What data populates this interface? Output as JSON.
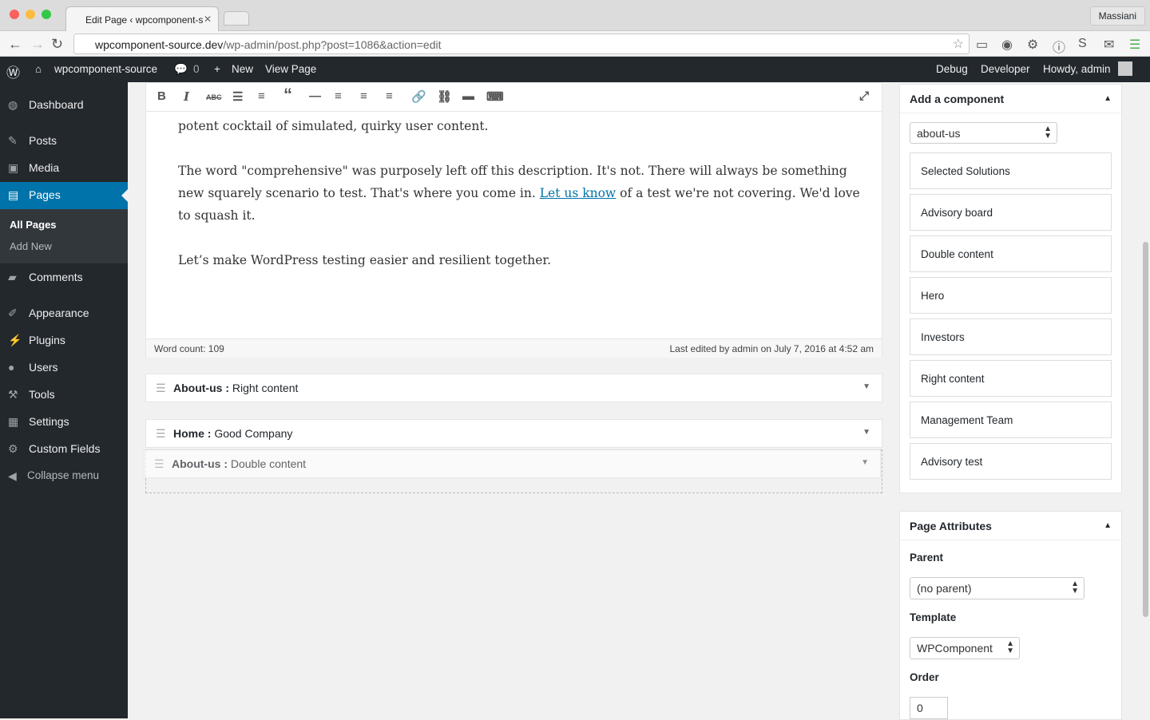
{
  "browser": {
    "tab_title": "Edit Page ‹ wpcomponent-s",
    "user": "Massiani",
    "url_host": "wpcomponent-source.dev",
    "url_path": "/wp-admin/post.php?post=1086&action=edit"
  },
  "adminbar": {
    "site_name": "wpcomponent-source",
    "comments_count": "0",
    "new_label": "New",
    "view_page": "View Page",
    "debug": "Debug",
    "developer": "Developer",
    "howdy": "Howdy, admin"
  },
  "sidebar": {
    "items": [
      {
        "label": "Dashboard",
        "icon": "dashboard-icon"
      },
      {
        "label": "Posts",
        "icon": "pin-icon"
      },
      {
        "label": "Media",
        "icon": "media-icon"
      },
      {
        "label": "Pages",
        "icon": "pages-icon"
      },
      {
        "label": "Comments",
        "icon": "comment-icon"
      },
      {
        "label": "Appearance",
        "icon": "brush-icon"
      },
      {
        "label": "Plugins",
        "icon": "plugin-icon"
      },
      {
        "label": "Users",
        "icon": "user-icon"
      },
      {
        "label": "Tools",
        "icon": "wrench-icon"
      },
      {
        "label": "Settings",
        "icon": "settings-icon"
      },
      {
        "label": "Custom Fields",
        "icon": "gear-icon"
      },
      {
        "label": "Collapse menu",
        "icon": "collapse-icon"
      }
    ],
    "submenu": [
      "All Pages",
      "Add New"
    ]
  },
  "editor": {
    "paragraph1": "lessons learned from over three years of theme and plugin support, and baffling corner cases, to create a potent cocktail of simulated, quirky user content.",
    "paragraph2_a": "The word \"comprehensive\" was purposely left off this description. It's not. There will always be something new squarely scenario to test. That's where you come in. ",
    "paragraph2_link": "Let us know",
    "paragraph2_b": " of a test we're not covering. We'd love to squash it.",
    "paragraph3": "Let’s make WordPress testing easier and resilient together.",
    "word_count": "Word count: 109",
    "last_edited": "Last edited by admin on July 7, 2016 at 4:52 am"
  },
  "components": [
    {
      "page": "About-us :",
      "name": " Right content"
    },
    {
      "page": "Home :",
      "name": " Good Company"
    },
    {
      "page": "About-us :",
      "name": " Double content"
    }
  ],
  "add_component": {
    "title": "Add a component",
    "selected": "about-us",
    "items": [
      "Selected Solutions",
      "Advisory board",
      "Double content",
      "Hero",
      "Investors",
      "Right content",
      "Management Team",
      "Advisory test"
    ]
  },
  "page_attributes": {
    "title": "Page Attributes",
    "parent_label": "Parent",
    "parent_value": "(no parent)",
    "template_label": "Template",
    "template_value": "WPComponent",
    "order_label": "Order",
    "order_value": "0"
  }
}
